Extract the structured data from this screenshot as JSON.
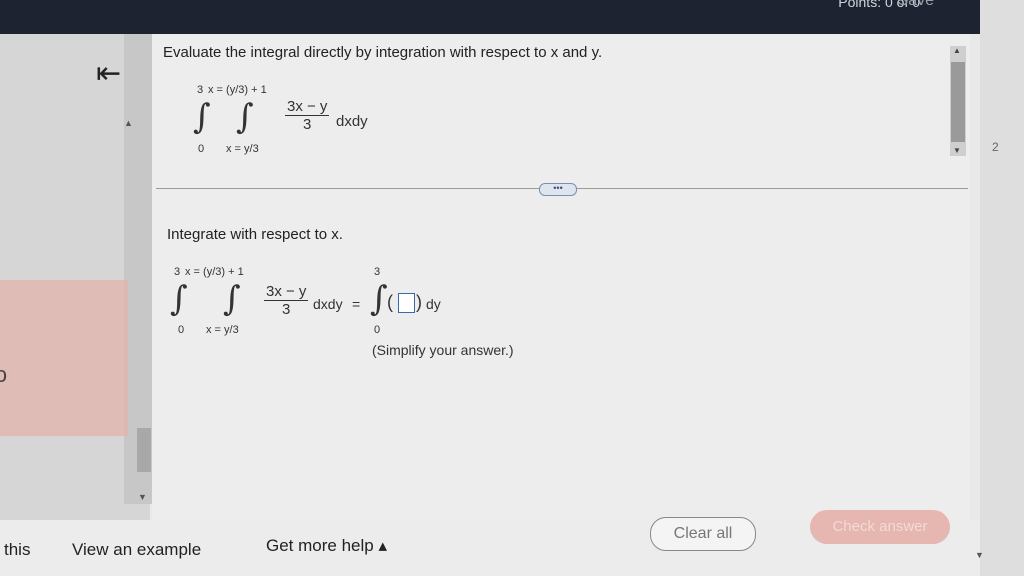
{
  "header": {
    "partial_text": "Points: 0 of 0",
    "save_label": "Save"
  },
  "nav": {
    "collapse_glyph": "⇤",
    "left_glyph": "ↄ"
  },
  "question": {
    "prompt": "Evaluate the integral directly by integration with respect to x and y.",
    "integral": {
      "outer_upper": "3",
      "outer_lower": "0",
      "inner_upper": "x = (y/3) + 1",
      "inner_lower": "x = y/3",
      "numerator": "3x − y",
      "denominator": "3",
      "differential": "dxdy"
    }
  },
  "step": {
    "instruction": "Integrate with respect to x.",
    "integral": {
      "outer_upper": "3",
      "outer_lower": "0",
      "inner_upper": "x = (y/3) + 1",
      "inner_lower": "x = y/3",
      "numerator": "3x − y",
      "denominator": "3",
      "differential": "dxdy"
    },
    "equals": "=",
    "rhs_upper": "3",
    "rhs_lower": "0",
    "rhs_differential": "dy",
    "answer_value": "",
    "hint": "(Simplify your answer.)"
  },
  "more_button": "•••",
  "right_edge_number": "2",
  "footer": {
    "edge_text": "this",
    "example": "View an example",
    "help": "Get more help ▴",
    "clear": "Clear all",
    "check": "Check answer"
  }
}
